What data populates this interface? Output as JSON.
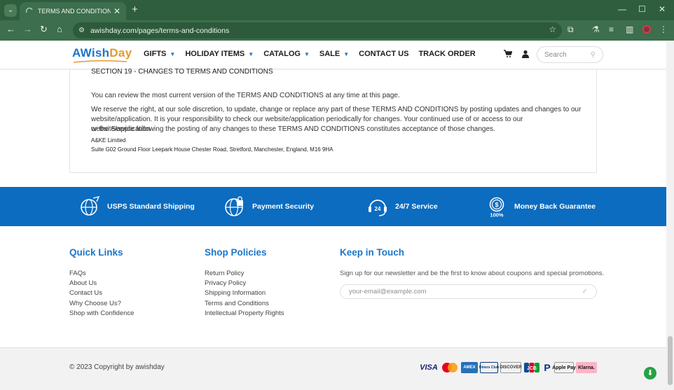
{
  "browser": {
    "tab_title": "TERMS AND CONDITIONS – a",
    "url": "awishday.com/pages/terms-and-conditions"
  },
  "header": {
    "logo_part1": "AWish",
    "logo_part2": "Day",
    "nav": [
      {
        "label": "GIFTS",
        "dropdown": true
      },
      {
        "label": "HOLIDAY ITEMS",
        "dropdown": true
      },
      {
        "label": "CATALOG",
        "dropdown": true
      },
      {
        "label": "SALE",
        "dropdown": true
      },
      {
        "label": "CONTACT US",
        "dropdown": false
      },
      {
        "label": "TRACK ORDER",
        "dropdown": false
      }
    ],
    "search_placeholder": "Search"
  },
  "content": {
    "section_title": "SECTION 19 - CHANGES TO TERMS AND CONDITIONS",
    "para1": "You can review the most current version of the TERMS AND CONDITIONS at any time at this page.",
    "para2_line1": "We reserve the right, at our sole discretion, to update, change or replace any part of these TERMS AND CONDITIONS by posting updates and changes to our",
    "para2_line2": "website/application. It is your responsibility to check our website/application periodically for changes. Your continued use of or access to our website/application",
    "para2_line3": "or the Service following the posting of any changes to these TERMS AND CONDITIONS constitutes acceptance of those changes.",
    "company": "A&KE Limited",
    "address": "Suite G02 Ground Floor Leepark House Chester Road, Stretford, Manchester, England, M16 9HA"
  },
  "features": [
    {
      "label": "USPS Standard Shipping",
      "icon": "globe-shipping-icon"
    },
    {
      "label": "Payment Security",
      "icon": "secure-globe-icon"
    },
    {
      "label": "24/7 Service",
      "icon": "headset-icon"
    },
    {
      "label": "Money Back Guarantee",
      "icon": "money-back-icon"
    }
  ],
  "footer": {
    "quick_links_title": "Quick Links",
    "quick_links": [
      "FAQs",
      "About Us",
      "Contact Us",
      "Why Choose Us?",
      "Shop with Confidence"
    ],
    "policies_title": "Shop Policies",
    "policies": [
      "Return Policy",
      "Privacy Policy",
      "Shipping Information",
      "Terms and Conditions",
      "Intellectual Property Rights"
    ],
    "keep_title": "Keep in Touch",
    "keep_text": "Sign up for our newsletter and be the first to know about coupons and special promotions.",
    "email_placeholder": "your-email@example.com",
    "copyright": "© 2023 Copyright by awishday",
    "payments": [
      "VISA",
      "Mastercard",
      "AMEX",
      "Diners Club",
      "DISCOVER",
      "JCB",
      "PayPal",
      "Apple Pay",
      "Klarna."
    ]
  },
  "colors": {
    "chrome": "#3d6e4d",
    "brand_blue": "#1b76c8",
    "band_blue": "#0b6cc0",
    "logo_orange": "#e49a2f"
  }
}
